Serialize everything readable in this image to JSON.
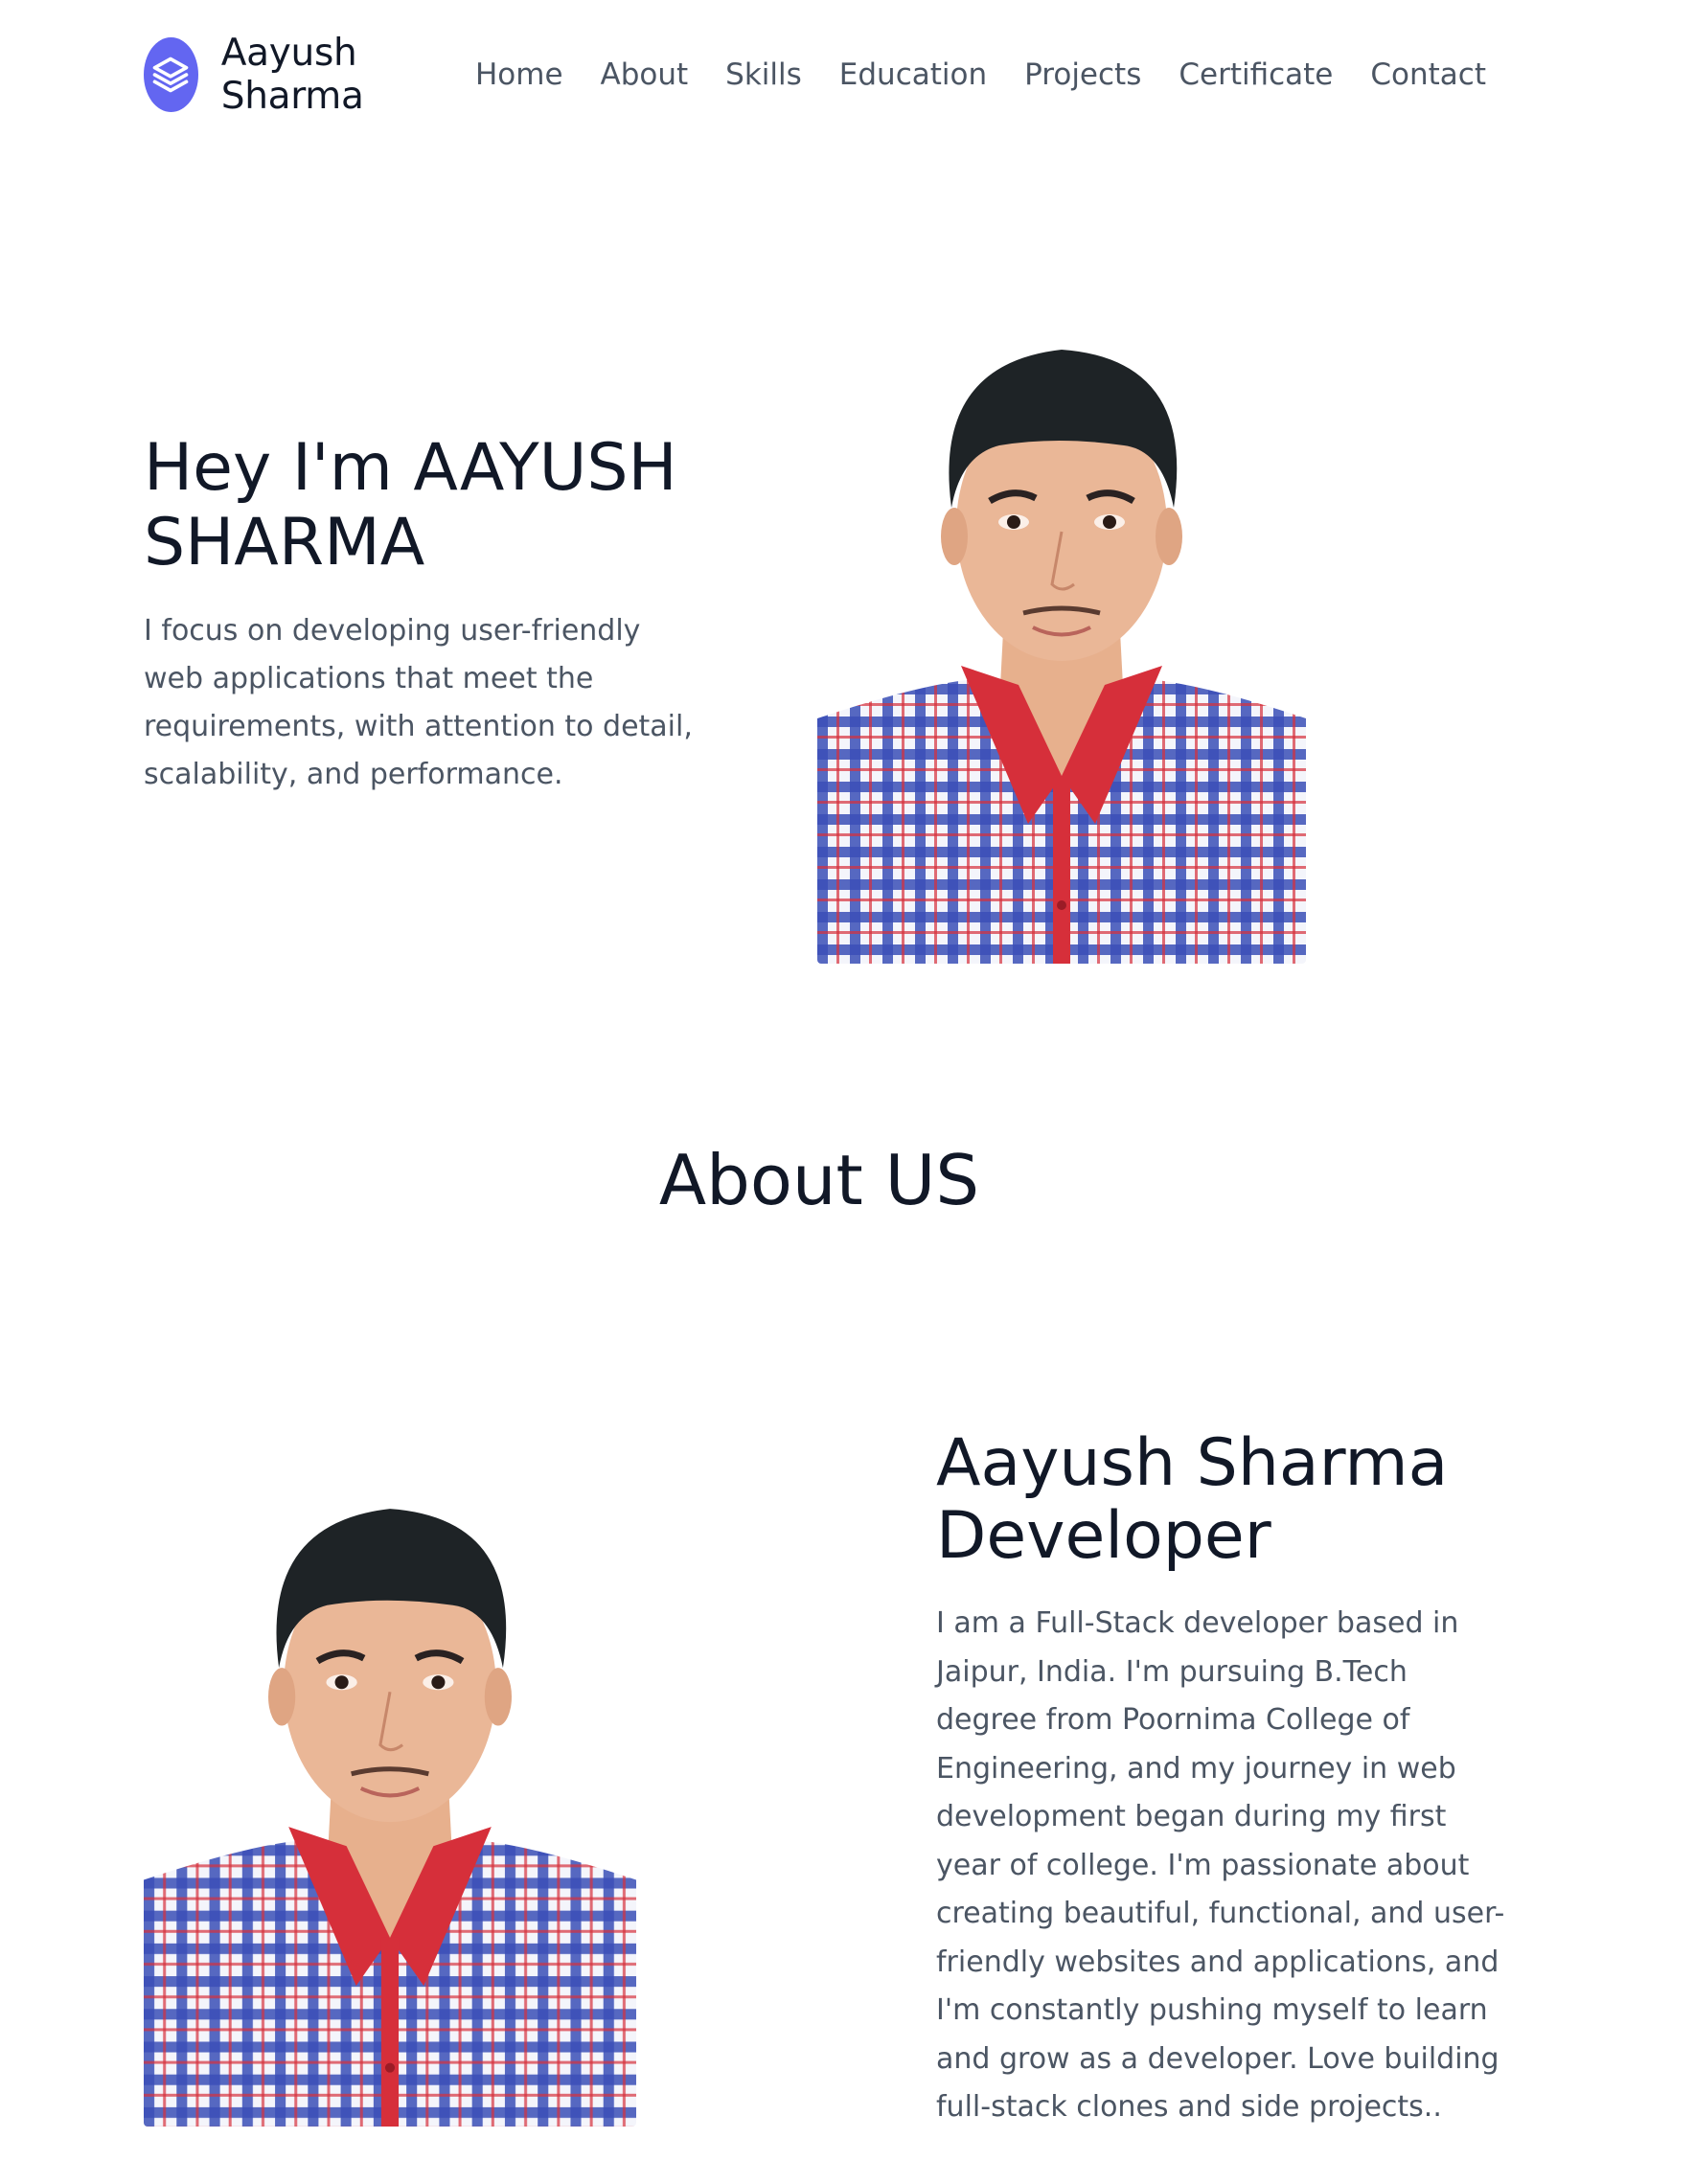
{
  "header": {
    "brand": "Aayush Sharma",
    "logo_icon": "stack-layers-icon",
    "nav": [
      "Home",
      "About",
      "Skills",
      "Education",
      "Projects",
      "Certificate",
      "Contact"
    ]
  },
  "hero": {
    "title_line1": "Hey I'm AAYUSH",
    "title_line2": "SHARMA",
    "description": "I focus on developing user-friendly web applications that meet the requirements, with attention to detail, scalability, and performance."
  },
  "about": {
    "section_title": "About US",
    "name_line1": "Aayush Sharma",
    "name_line2": "Developer",
    "bio": "I am a Full-Stack developer based in Jaipur, India. I'm pursuing B.Tech degree from Poornima College of Engineering, and my journey in web development began during my first year of college. I'm passionate about creating beautiful, functional, and user-friendly websites and applications, and I'm constantly pushing myself to learn and grow as a developer. Love building full-stack clones and side projects.."
  },
  "colors": {
    "accent": "#6366f1",
    "heading": "#111827",
    "body_text": "#4b5563",
    "shirt_blue": "#3b4fb8",
    "collar_red": "#d62f3a"
  }
}
